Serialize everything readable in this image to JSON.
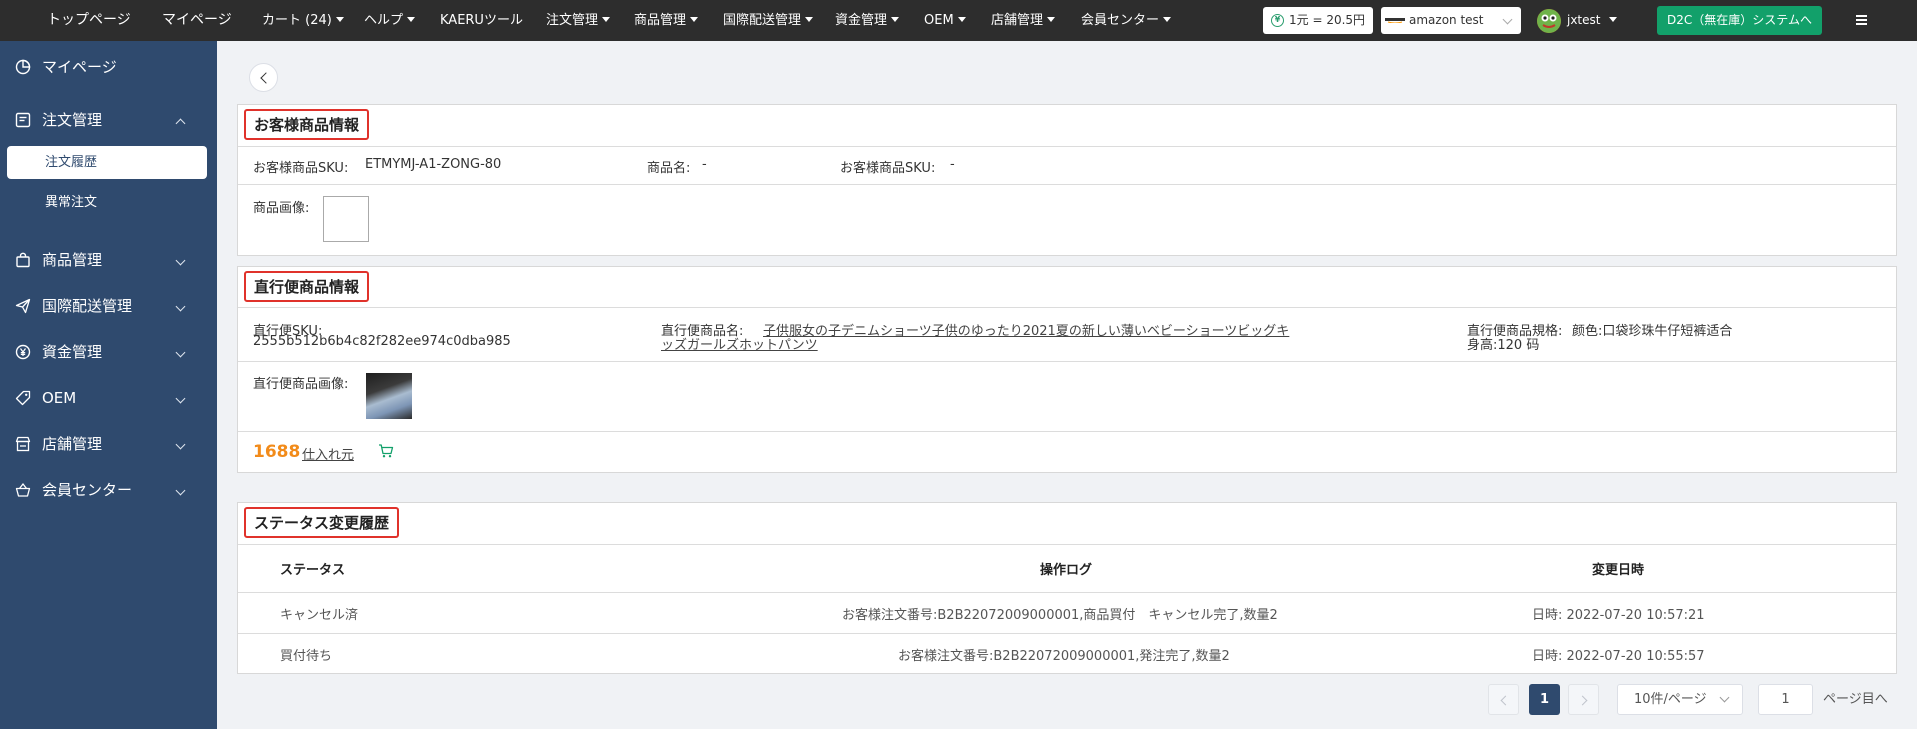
{
  "topbar": {
    "nav": [
      {
        "label": "トップページ",
        "dropdown": false
      },
      {
        "label": "マイページ",
        "dropdown": false
      },
      {
        "label": "カート (24)",
        "dropdown": true
      },
      {
        "label": "ヘルプ",
        "dropdown": true
      },
      {
        "label": "KAERUツール",
        "dropdown": false
      },
      {
        "label": "注文管理",
        "dropdown": true
      },
      {
        "label": "商品管理",
        "dropdown": true
      },
      {
        "label": "国際配送管理",
        "dropdown": true
      },
      {
        "label": "資金管理",
        "dropdown": true
      },
      {
        "label": "OEM",
        "dropdown": true
      },
      {
        "label": "店舗管理",
        "dropdown": true
      },
      {
        "label": "会員センター",
        "dropdown": true
      }
    ],
    "exchange_rate": "1元 = 20.5円",
    "store_select_value": "amazon test",
    "store_logo_text": "amazon",
    "user_name": "jxtest",
    "d2c_button": "D2C（無在庫）システムへ"
  },
  "sidebar": {
    "items": [
      {
        "label": "マイページ",
        "icon": "pie-chart-icon",
        "expanded": false,
        "has_children": false
      },
      {
        "label": "注文管理",
        "icon": "order-list-icon",
        "expanded": true,
        "has_children": true
      },
      {
        "label": "商品管理",
        "icon": "shopping-bag-icon",
        "expanded": false,
        "has_children": true
      },
      {
        "label": "国際配送管理",
        "icon": "paper-plane-icon",
        "expanded": false,
        "has_children": true
      },
      {
        "label": "資金管理",
        "icon": "yen-circle-icon",
        "expanded": false,
        "has_children": true
      },
      {
        "label": "OEM",
        "icon": "tag-icon",
        "expanded": false,
        "has_children": true
      },
      {
        "label": "店舗管理",
        "icon": "store-icon",
        "expanded": false,
        "has_children": true
      },
      {
        "label": "会員センター",
        "icon": "basket-icon",
        "expanded": false,
        "has_children": true
      }
    ],
    "sub_items": [
      {
        "label": "注文履歴",
        "active": true
      },
      {
        "label": "異常注文",
        "active": false
      }
    ]
  },
  "customer_product": {
    "title": "お客様商品情報",
    "sku_label": "お客様商品SKU:",
    "sku_value": "ETMYMJ-A1-ZONG-80",
    "name_label": "商品名:",
    "name_value": "-",
    "sku2_label": "お客様商品SKU:",
    "sku2_value": "-",
    "image_label": "商品画像:"
  },
  "direct_product": {
    "title": "直行便商品情報",
    "sku_label": "直行便SKU:",
    "sku_value": "2555b512b6b4c82f282ee974c0dba985",
    "name_label": "直行便商品名:",
    "name_value_line1": "子供服女の子デニムショーツ子供のゆったり2021夏の新しい薄いベビーショーツビッグキ",
    "name_value_line2": "ッズガールズホットパンツ",
    "spec_label": "直行便商品規格:",
    "spec_value_line1": "颜色:口袋珍珠牛仔短裤适合",
    "spec_value_line2": "身高:120 码",
    "image_label": "直行便商品画像:",
    "brand": "1688",
    "supplier_link": "仕入れ元"
  },
  "status_history": {
    "title": "ステータス変更履歴",
    "columns": [
      "ステータス",
      "操作ログ",
      "変更日時"
    ],
    "rows": [
      {
        "status": "キャンセル済",
        "log": "お客様注文番号:B2B22072009000001,商品買付　キャンセル完了,数量2",
        "time": "日時: 2022-07-20 10:57:21"
      },
      {
        "status": "買付待ち",
        "log": "お客様注文番号:B2B22072009000001,発注完了,数量2",
        "time": "日時: 2022-07-20 10:55:57"
      }
    ]
  },
  "pagination": {
    "current_page": "1",
    "page_size": "10件/ページ",
    "goto_value": "1",
    "goto_label": "ページ目へ"
  },
  "colors": {
    "topbar_bg": "#2d2d2d",
    "sidebar_bg": "#2f4a6e",
    "accent_green": "#12a06a",
    "title_border_red": "#e0322b",
    "brand_orange": "#f28b1a"
  }
}
